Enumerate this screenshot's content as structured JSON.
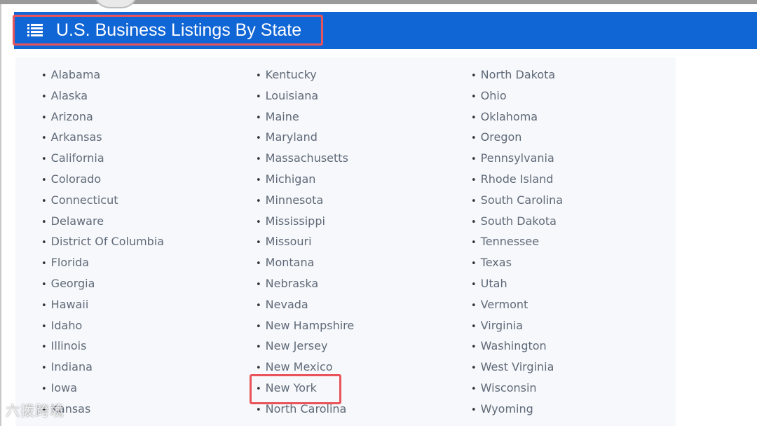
{
  "header": {
    "title": "U.S. Business Listings By State",
    "icon": "list-icon",
    "background_color": "#1166d6"
  },
  "highlight_color": "#e8545a",
  "columns": [
    [
      "Alabama",
      "Alaska",
      "Arizona",
      "Arkansas",
      "California",
      "Colorado",
      "Connecticut",
      "Delaware",
      "District Of Columbia",
      "Florida",
      "Georgia",
      "Hawaii",
      "Idaho",
      "Illinois",
      "Indiana",
      "Iowa",
      "Kansas"
    ],
    [
      "Kentucky",
      "Louisiana",
      "Maine",
      "Maryland",
      "Massachusetts",
      "Michigan",
      "Minnesota",
      "Mississippi",
      "Missouri",
      "Montana",
      "Nebraska",
      "Nevada",
      "New Hampshire",
      "New Jersey",
      "New Mexico",
      "New York",
      "North Carolina"
    ],
    [
      "North Dakota",
      "Ohio",
      "Oklahoma",
      "Oregon",
      "Pennsylvania",
      "Rhode Island",
      "South Carolina",
      "South Dakota",
      "Tennessee",
      "Texas",
      "Utah",
      "Vermont",
      "Virginia",
      "Washington",
      "West Virginia",
      "Wisconsin",
      "Wyoming"
    ]
  ],
  "highlighted_item": "New York",
  "watermark": "六拨跨境"
}
